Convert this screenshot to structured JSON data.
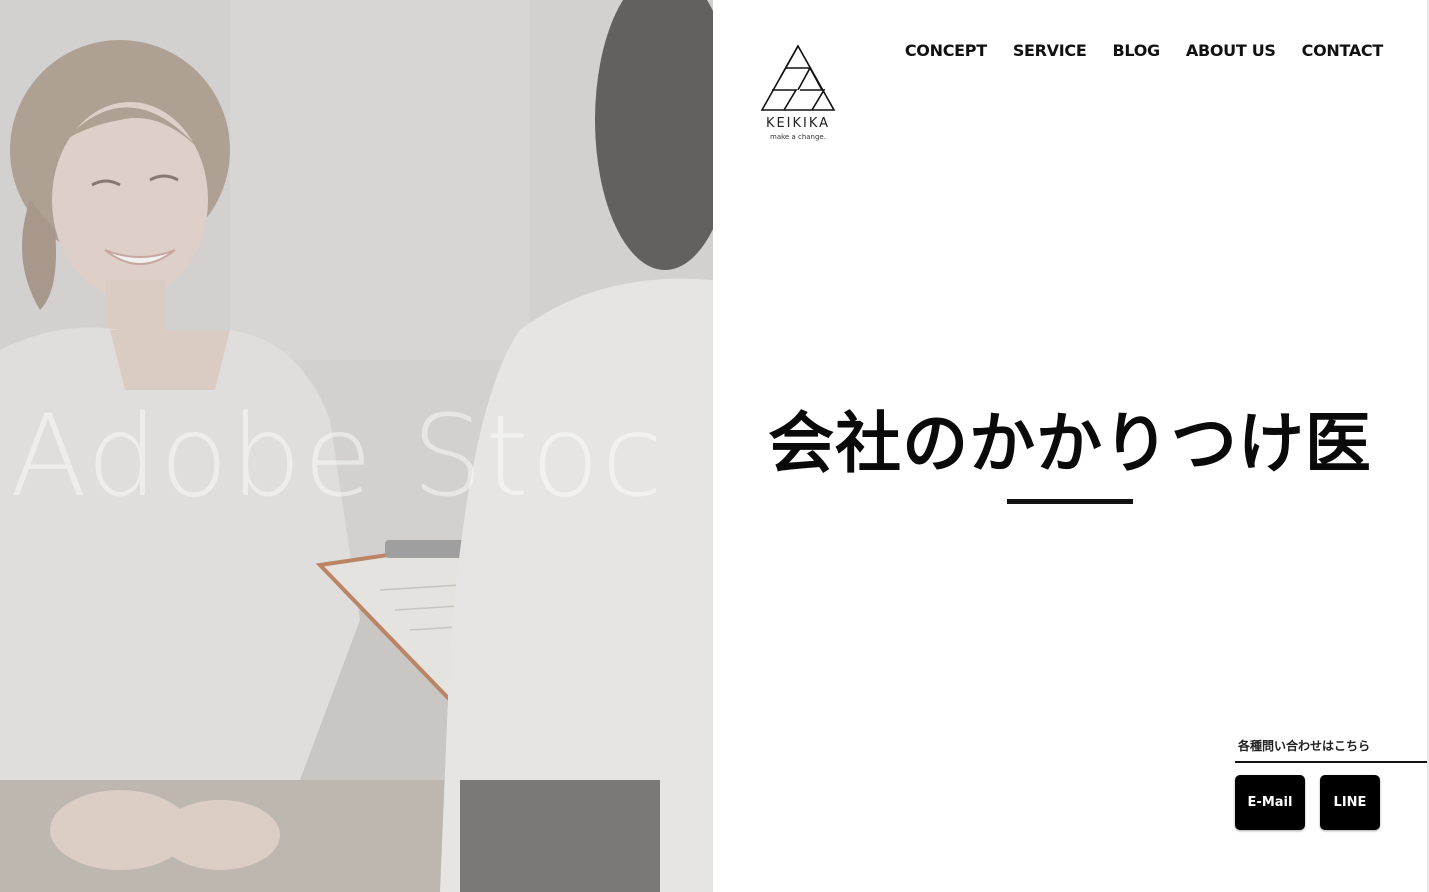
{
  "brand": {
    "name": "KEIKIKA",
    "tagline": "make a change."
  },
  "nav": {
    "items": [
      "CONCEPT",
      "SERVICE",
      "BLOG",
      "ABOUT US",
      "CONTACT"
    ]
  },
  "hero": {
    "watermark": "Adobe Stoc",
    "headline": "会社のかかりつけ医"
  },
  "contact": {
    "label": "各種問い合わせはこちら",
    "email_label": "E-Mail",
    "line_label": "LINE"
  },
  "colors": {
    "text": "#111111",
    "button_bg": "#000000",
    "button_text": "#ffffff",
    "background": "#ffffff"
  }
}
